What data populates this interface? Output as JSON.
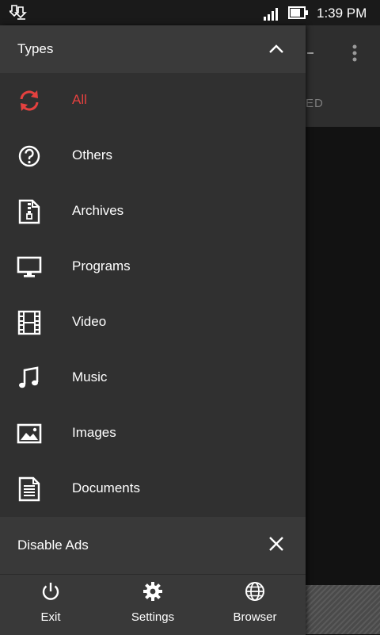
{
  "status_bar": {
    "time": "1:39 PM"
  },
  "app_behind": {
    "tab_partial": "ED"
  },
  "drawer": {
    "header_title": "Types",
    "items": [
      {
        "label": "All",
        "icon": "sync-icon",
        "active": true
      },
      {
        "label": "Others",
        "icon": "question-circle-icon",
        "active": false
      },
      {
        "label": "Archives",
        "icon": "archive-file-icon",
        "active": false
      },
      {
        "label": "Programs",
        "icon": "monitor-icon",
        "active": false
      },
      {
        "label": "Video",
        "icon": "film-icon",
        "active": false
      },
      {
        "label": "Music",
        "icon": "music-note-icon",
        "active": false
      },
      {
        "label": "Images",
        "icon": "image-icon",
        "active": false
      },
      {
        "label": "Documents",
        "icon": "document-icon",
        "active": false
      }
    ],
    "disable_ads_label": "Disable Ads",
    "bottom_bar": [
      {
        "label": "Exit",
        "icon": "power-icon"
      },
      {
        "label": "Settings",
        "icon": "gear-icon"
      },
      {
        "label": "Browser",
        "icon": "globe-icon"
      }
    ]
  },
  "colors": {
    "accent": "#e5413f",
    "drawer_bg": "#303030",
    "header_bg": "#3a3a3a"
  }
}
